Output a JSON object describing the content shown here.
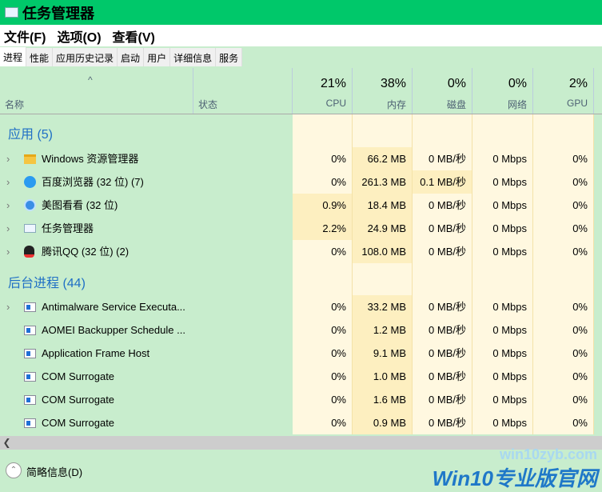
{
  "window": {
    "title": "任务管理器"
  },
  "menu": [
    "文件(F)",
    "选项(O)",
    "查看(V)"
  ],
  "tabs": [
    "进程",
    "性能",
    "应用历史记录",
    "启动",
    "用户",
    "详细信息",
    "服务"
  ],
  "header": {
    "name": "名称",
    "status": "状态",
    "sort_icon": "^",
    "cols": [
      {
        "pct": "21%",
        "label": "CPU"
      },
      {
        "pct": "38%",
        "label": "内存"
      },
      {
        "pct": "0%",
        "label": "磁盘"
      },
      {
        "pct": "0%",
        "label": "网络"
      },
      {
        "pct": "2%",
        "label": "GPU"
      }
    ]
  },
  "groups": [
    {
      "title": "应用 (5)",
      "rows": [
        {
          "name": "Windows 资源管理器",
          "icon": "folder-icon",
          "expand": true,
          "values": [
            "0%",
            "66.2 MB",
            "0 MB/秒",
            "0 Mbps",
            "0%"
          ],
          "heat": [
            0,
            1,
            0,
            0,
            0
          ]
        },
        {
          "name": "百度浏览器 (32 位) (7)",
          "icon": "browser-icon",
          "expand": true,
          "values": [
            "0%",
            "261.3 MB",
            "0.1 MB/秒",
            "0 Mbps",
            "0%"
          ],
          "heat": [
            0,
            1,
            1,
            0,
            0
          ]
        },
        {
          "name": "美图看看 (32 位)",
          "icon": "image-viewer-icon",
          "expand": true,
          "values": [
            "0.9%",
            "18.4 MB",
            "0 MB/秒",
            "0 Mbps",
            "0%"
          ],
          "heat": [
            1,
            1,
            0,
            0,
            0
          ]
        },
        {
          "name": "任务管理器",
          "icon": "task-manager-icon",
          "expand": true,
          "values": [
            "2.2%",
            "24.9 MB",
            "0 MB/秒",
            "0 Mbps",
            "0%"
          ],
          "heat": [
            1,
            1,
            0,
            0,
            0
          ]
        },
        {
          "name": "腾讯QQ (32 位) (2)",
          "icon": "qq-icon",
          "expand": true,
          "values": [
            "0%",
            "108.0 MB",
            "0 MB/秒",
            "0 Mbps",
            "0%"
          ],
          "heat": [
            0,
            1,
            0,
            0,
            0
          ]
        }
      ]
    },
    {
      "title": "后台进程 (44)",
      "rows": [
        {
          "name": "Antimalware Service Executa...",
          "icon": "service-icon",
          "expand": true,
          "values": [
            "0%",
            "33.2 MB",
            "0 MB/秒",
            "0 Mbps",
            "0%"
          ],
          "heat": [
            0,
            1,
            0,
            0,
            0
          ]
        },
        {
          "name": "AOMEI Backupper Schedule ...",
          "icon": "service-icon",
          "expand": false,
          "values": [
            "0%",
            "1.2 MB",
            "0 MB/秒",
            "0 Mbps",
            "0%"
          ],
          "heat": [
            0,
            1,
            0,
            0,
            0
          ]
        },
        {
          "name": "Application Frame Host",
          "icon": "service-icon",
          "expand": false,
          "values": [
            "0%",
            "9.1 MB",
            "0 MB/秒",
            "0 Mbps",
            "0%"
          ],
          "heat": [
            0,
            1,
            0,
            0,
            0
          ]
        },
        {
          "name": "COM Surrogate",
          "icon": "service-icon",
          "expand": false,
          "values": [
            "0%",
            "1.0 MB",
            "0 MB/秒",
            "0 Mbps",
            "0%"
          ],
          "heat": [
            0,
            1,
            0,
            0,
            0
          ]
        },
        {
          "name": "COM Surrogate",
          "icon": "service-icon",
          "expand": false,
          "values": [
            "0%",
            "1.6 MB",
            "0 MB/秒",
            "0 Mbps",
            "0%"
          ],
          "heat": [
            0,
            1,
            0,
            0,
            0
          ]
        },
        {
          "name": "COM Surrogate",
          "icon": "service-icon",
          "expand": false,
          "values": [
            "0%",
            "0.9 MB",
            "0 MB/秒",
            "0 Mbps",
            "0%"
          ],
          "heat": [
            0,
            1,
            0,
            0,
            0
          ]
        }
      ]
    }
  ],
  "footer": {
    "label": "简略信息(D)",
    "watermark_url": "win10zyb.com",
    "watermark_brand": "Win10专业版官网"
  }
}
